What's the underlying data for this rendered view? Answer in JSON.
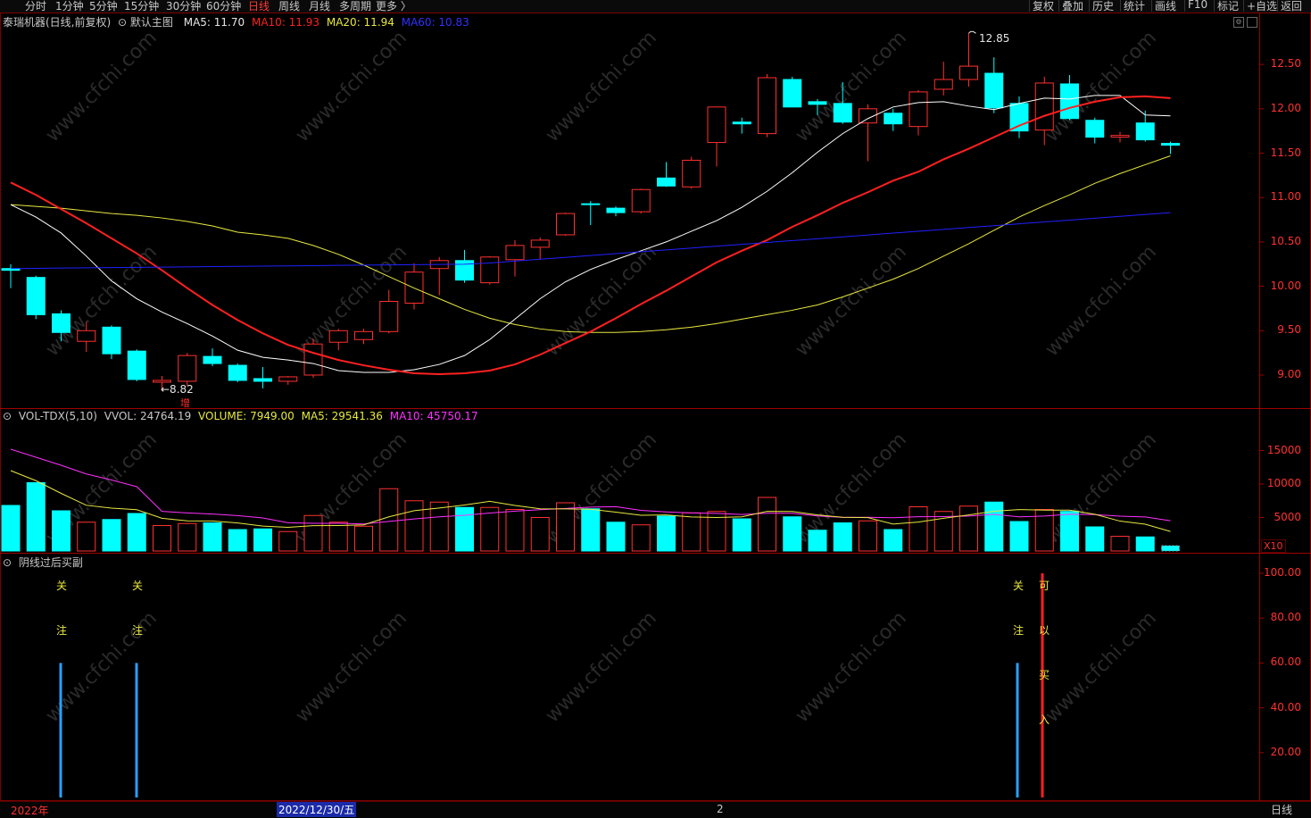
{
  "toolbar": {
    "periods": [
      {
        "label": "分时",
        "active": false
      },
      {
        "label": "1分钟",
        "active": false
      },
      {
        "label": "5分钟",
        "active": false
      },
      {
        "label": "15分钟",
        "active": false
      },
      {
        "label": "30分钟",
        "active": false
      },
      {
        "label": "60分钟",
        "active": false
      },
      {
        "label": "日线",
        "active": true
      },
      {
        "label": "周线",
        "active": false
      },
      {
        "label": "月线",
        "active": false
      },
      {
        "label": "多周期",
        "active": false
      },
      {
        "label": "更多 〉",
        "active": false
      }
    ],
    "right_buttons": [
      "复权",
      "叠加",
      "历史",
      "统计",
      "画线",
      "F10",
      "+自选",
      "返回"
    ],
    "right_first_partial": "标记"
  },
  "main_panel": {
    "stock_name": "泰瑞机器(日线,前复权)",
    "template": "默认主图",
    "ma5_label": "MA5: 11.70",
    "ma10_label": "MA10: 11.93",
    "ma20_label": "MA20: 11.94",
    "ma60_label": "MA60: 10.83",
    "colors": {
      "ma5": "#ffffff",
      "ma10": "#ff2020",
      "ma20": "#e8e840",
      "ma60": "#2020ff",
      "up": "#ff3030",
      "down": "#00ffff"
    },
    "high_marker": "12.85",
    "low_marker": "←8.82",
    "event_tag": "增",
    "y_ticks": [
      "12.50",
      "12.00",
      "11.50",
      "11.00",
      "10.50",
      "10.00",
      "9.50",
      "9.00"
    ]
  },
  "volume_panel": {
    "indicator": "VOL-TDX(5,10)",
    "vvol": "VVOL: 24764.19",
    "volume": "VOLUME: 7949.00",
    "ma5": "MA5: 29541.36",
    "ma10": "MA10: 45750.17",
    "y_ticks": [
      "15000",
      "10000",
      "5000"
    ],
    "multiplier": "X10"
  },
  "signal_panel": {
    "title": "阴线过后买副",
    "y_ticks": [
      "100.00",
      "80.00",
      "60.00",
      "40.00",
      "20.00"
    ],
    "signals": [
      {
        "chars": [
          "关",
          "注"
        ],
        "color": "#e8e840"
      },
      {
        "chars": [
          "关",
          "注"
        ],
        "color": "#e8e840"
      },
      {
        "chars": [
          "关",
          "注"
        ],
        "color": "#e8e840"
      },
      {
        "chars": [
          "可",
          "以",
          "买",
          "入"
        ],
        "color": "#e8e840"
      }
    ]
  },
  "bottom_bar": {
    "year_label": "2022年",
    "cursor_date": "2022/12/30/五",
    "month_marker": "2",
    "period_label": "日线"
  },
  "watermark": "www.cfchi.com",
  "chart_data": {
    "type": "candlestick",
    "candles": [
      {
        "o": 10.2,
        "h": 10.25,
        "l": 9.98,
        "c": 10.18
      },
      {
        "o": 10.1,
        "h": 10.12,
        "l": 9.63,
        "c": 9.68
      },
      {
        "o": 9.69,
        "h": 9.73,
        "l": 9.38,
        "c": 9.48
      },
      {
        "o": 9.38,
        "h": 9.6,
        "l": 9.26,
        "c": 9.5
      },
      {
        "o": 9.54,
        "h": 9.56,
        "l": 9.18,
        "c": 9.24
      },
      {
        "o": 9.27,
        "h": 9.29,
        "l": 8.93,
        "c": 8.95
      },
      {
        "o": 8.92,
        "h": 8.99,
        "l": 8.82,
        "c": 8.94
      },
      {
        "o": 8.93,
        "h": 9.25,
        "l": 8.88,
        "c": 9.22
      },
      {
        "o": 9.21,
        "h": 9.3,
        "l": 9.1,
        "c": 9.13
      },
      {
        "o": 9.11,
        "h": 9.13,
        "l": 8.92,
        "c": 8.94
      },
      {
        "o": 8.96,
        "h": 9.09,
        "l": 8.85,
        "c": 8.93
      },
      {
        "o": 8.93,
        "h": 8.99,
        "l": 8.89,
        "c": 8.98
      },
      {
        "o": 9.0,
        "h": 9.41,
        "l": 8.97,
        "c": 9.35
      },
      {
        "o": 9.37,
        "h": 9.52,
        "l": 9.28,
        "c": 9.5
      },
      {
        "o": 9.4,
        "h": 9.52,
        "l": 9.35,
        "c": 9.49
      },
      {
        "o": 9.49,
        "h": 9.96,
        "l": 9.47,
        "c": 9.83
      },
      {
        "o": 9.81,
        "h": 10.26,
        "l": 9.74,
        "c": 10.16
      },
      {
        "o": 10.2,
        "h": 10.33,
        "l": 9.9,
        "c": 10.29
      },
      {
        "o": 10.29,
        "h": 10.41,
        "l": 10.04,
        "c": 10.07
      },
      {
        "o": 10.04,
        "h": 10.34,
        "l": 10.02,
        "c": 10.33
      },
      {
        "o": 10.3,
        "h": 10.52,
        "l": 10.11,
        "c": 10.46
      },
      {
        "o": 10.44,
        "h": 10.55,
        "l": 10.3,
        "c": 10.52
      },
      {
        "o": 10.58,
        "h": 10.83,
        "l": 10.57,
        "c": 10.82
      },
      {
        "o": 10.93,
        "h": 10.96,
        "l": 10.69,
        "c": 10.92
      },
      {
        "o": 10.88,
        "h": 10.9,
        "l": 10.79,
        "c": 10.83
      },
      {
        "o": 10.84,
        "h": 11.1,
        "l": 10.82,
        "c": 11.09
      },
      {
        "o": 11.22,
        "h": 11.4,
        "l": 11.12,
        "c": 11.13
      },
      {
        "o": 11.12,
        "h": 11.46,
        "l": 11.1,
        "c": 11.42
      },
      {
        "o": 11.62,
        "h": 11.98,
        "l": 11.35,
        "c": 12.02
      },
      {
        "o": 11.85,
        "h": 11.9,
        "l": 11.72,
        "c": 11.83
      },
      {
        "o": 11.72,
        "h": 12.39,
        "l": 11.68,
        "c": 12.35
      },
      {
        "o": 12.33,
        "h": 12.36,
        "l": 12.04,
        "c": 12.02
      },
      {
        "o": 12.08,
        "h": 12.11,
        "l": 11.93,
        "c": 12.05
      },
      {
        "o": 12.06,
        "h": 12.3,
        "l": 11.83,
        "c": 11.85
      },
      {
        "o": 11.84,
        "h": 12.05,
        "l": 11.41,
        "c": 12.0
      },
      {
        "o": 11.95,
        "h": 12.0,
        "l": 11.75,
        "c": 11.83
      },
      {
        "o": 11.8,
        "h": 12.21,
        "l": 11.7,
        "c": 12.19
      },
      {
        "o": 12.22,
        "h": 12.53,
        "l": 12.15,
        "c": 12.33
      },
      {
        "o": 12.33,
        "h": 12.85,
        "l": 12.25,
        "c": 12.48
      },
      {
        "o": 12.4,
        "h": 12.58,
        "l": 11.95,
        "c": 12.01
      },
      {
        "o": 12.06,
        "h": 12.14,
        "l": 11.67,
        "c": 11.75
      },
      {
        "o": 11.76,
        "h": 12.36,
        "l": 11.59,
        "c": 12.29
      },
      {
        "o": 12.28,
        "h": 12.38,
        "l": 11.87,
        "c": 11.89
      },
      {
        "o": 11.87,
        "h": 11.9,
        "l": 11.61,
        "c": 11.68
      },
      {
        "o": 11.68,
        "h": 11.74,
        "l": 11.62,
        "c": 11.7
      },
      {
        "o": 11.84,
        "h": 11.98,
        "l": 11.63,
        "c": 11.65
      },
      {
        "o": 11.61,
        "h": 11.63,
        "l": 11.49,
        "c": 11.59
      }
    ],
    "ma5": [
      10.92,
      10.78,
      10.6,
      10.34,
      10.06,
      9.86,
      9.71,
      9.58,
      9.44,
      9.28,
      9.2,
      9.17,
      9.13,
      9.05,
      9.03,
      9.03,
      9.06,
      9.12,
      9.22,
      9.4,
      9.63,
      9.86,
      10.05,
      10.19,
      10.3,
      10.4,
      10.5,
      10.62,
      10.74,
      10.89,
      11.07,
      11.28,
      11.51,
      11.72,
      11.89,
      12.02,
      12.07,
      12.08,
      12.03,
      11.99,
      12.06,
      12.12,
      12.11,
      12.15,
      12.15,
      11.93,
      11.92,
      11.84,
      11.7
    ],
    "ma10": [
      11.17,
      11.03,
      10.87,
      10.71,
      10.54,
      10.37,
      10.18,
      9.98,
      9.79,
      9.62,
      9.47,
      9.34,
      9.25,
      9.17,
      9.11,
      9.06,
      9.02,
      9.01,
      9.02,
      9.05,
      9.12,
      9.23,
      9.36,
      9.49,
      9.64,
      9.8,
      9.95,
      10.11,
      10.27,
      10.4,
      10.52,
      10.67,
      10.8,
      10.94,
      11.06,
      11.19,
      11.29,
      11.43,
      11.55,
      11.68,
      11.81,
      11.92,
      12.01,
      12.08,
      12.13,
      12.14,
      12.12,
      12.1,
      12.09,
      12.05,
      12.0,
      11.97,
      11.95,
      11.93
    ],
    "ma20": [
      10.92,
      10.9,
      10.88,
      10.85,
      10.82,
      10.8,
      10.77,
      10.73,
      10.68,
      10.61,
      10.58,
      10.54,
      10.46,
      10.36,
      10.24,
      10.11,
      9.98,
      9.86,
      9.74,
      9.64,
      9.57,
      9.52,
      9.49,
      9.48,
      9.48,
      9.49,
      9.51,
      9.54,
      9.58,
      9.63,
      9.68,
      9.73,
      9.79,
      9.88,
      9.98,
      10.08,
      10.2,
      10.34,
      10.48,
      10.63,
      10.78,
      10.91,
      11.03,
      11.16,
      11.27,
      11.37,
      11.47,
      11.55,
      11.64,
      11.7,
      11.76,
      11.8,
      11.84,
      11.87,
      11.89,
      11.91,
      11.93,
      11.94
    ],
    "ma60_start": 10.2,
    "ma60_end": 10.83,
    "volume": [
      6800,
      10200,
      6000,
      4300,
      4700,
      5600,
      3800,
      4100,
      4200,
      3200,
      3300,
      2900,
      5300,
      4300,
      3700,
      9300,
      7500,
      7300,
      6500,
      6500,
      6200,
      5000,
      7200,
      6300,
      4300,
      3900,
      5200,
      5700,
      5900,
      4800,
      8000,
      5100,
      3100,
      4200,
      4500,
      3200,
      6600,
      5900,
      6700,
      7300,
      4400,
      6200,
      5900,
      3600,
      2200,
      2100,
      800
    ]
  }
}
